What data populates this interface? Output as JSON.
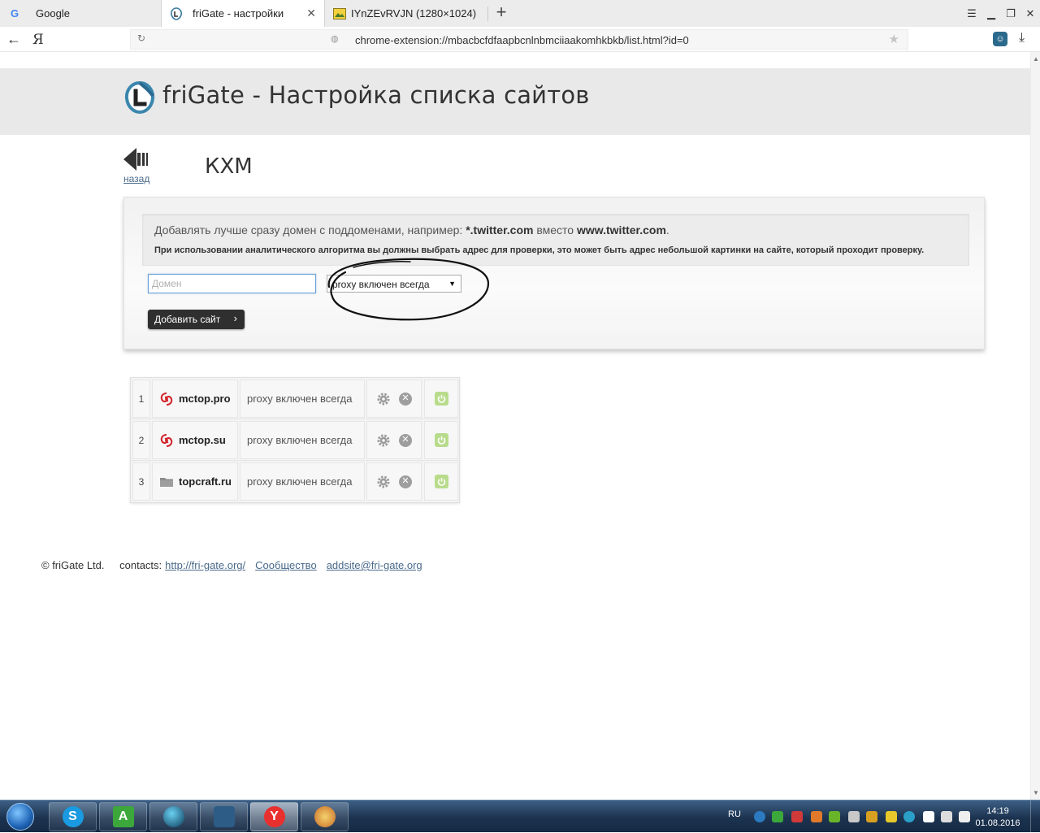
{
  "browser": {
    "tabs": [
      {
        "title": "Google",
        "favicon": "google-g-icon"
      },
      {
        "title": "friGate - настройки",
        "favicon": "frigate-icon",
        "active": true
      },
      {
        "title": "IYnZEvRVJN (1280×1024)",
        "favicon": "image-icon"
      }
    ],
    "tab_close": "✕",
    "new_tab": "+",
    "yandex_label": "Я",
    "url": "chrome-extension://mbacbcfdfaapbcnlnbmciiaakomhkbkb/list.html?id=0"
  },
  "page": {
    "title": "friGate - Настройка списка сайтов",
    "back_label": "назад",
    "list_name": "КХМ",
    "notice": {
      "line1_pre": "Добавлять лучше сразу домен с поддоменами, например: ",
      "line1_ex1": "*.twitter.com",
      "line1_mid": " вместо ",
      "line1_ex2": "www.twitter.com",
      "line1_post": ".",
      "line2": "При использовании аналитического алгоритма вы должны выбрать адрес для проверки, это может быть адрес небольшой картинки на сайте, который проходит проверку."
    },
    "domain_placeholder": "Домен",
    "mode_selected": "proxy включен всегда",
    "add_button": "Добавить сайт",
    "sites": [
      {
        "num": "1",
        "domain": "mctop.pro",
        "mode": "proxy включен всегда",
        "icon": "mctop-icon"
      },
      {
        "num": "2",
        "domain": "mctop.su",
        "mode": "proxy включен всегда",
        "icon": "mctop-icon"
      },
      {
        "num": "3",
        "domain": "topcraft.ru",
        "mode": "proxy включен всегда",
        "icon": "folder-icon"
      }
    ]
  },
  "footer": {
    "copyright": "© friGate Ltd.",
    "contacts_label": "contacts:",
    "link1": "http://fri-gate.org/",
    "link2": "Сообщество",
    "link3": "addsite@fri-gate.org"
  },
  "taskbar": {
    "lang": "RU",
    "time": "14:19",
    "date": "01.08.2016",
    "apps": [
      "skype-icon",
      "a-green-icon",
      "globe-dark-icon",
      "photo-app-icon",
      "yandex-browser-icon",
      "paint-icon"
    ]
  },
  "colors": {
    "header_band": "#e9e9e9",
    "button_dark": "#2f2f2f",
    "link": "#4a6a8a",
    "power_green": "#b8dc8c"
  }
}
